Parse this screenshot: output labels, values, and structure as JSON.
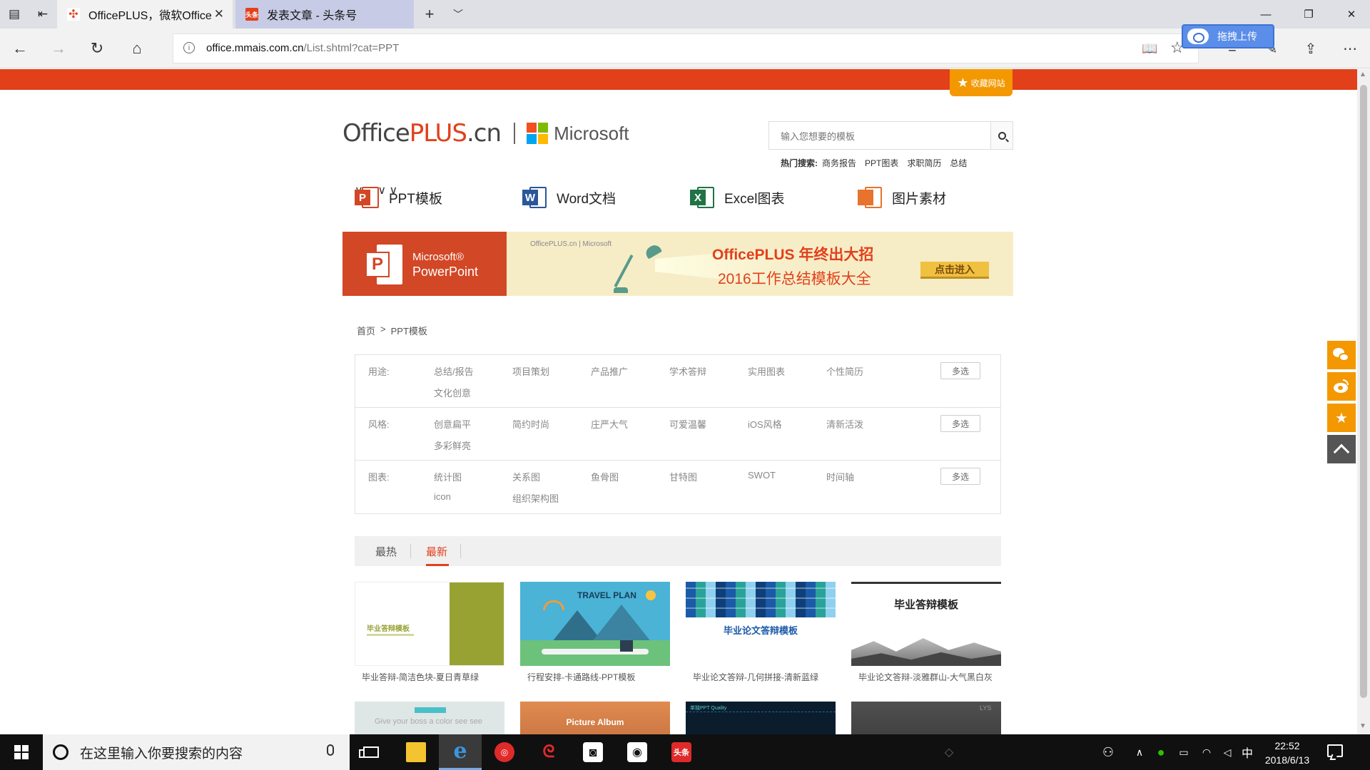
{
  "browser": {
    "tabs": [
      {
        "label": "OfficePLUS，微软Office",
        "active": true
      },
      {
        "label": "发表文章 - 头条号",
        "active": false,
        "favicon_text": "头条"
      }
    ],
    "url_domain": "office.mmais.com.cn",
    "url_path": "/List.shtml?cat=PPT",
    "upload_label": "拖拽上传"
  },
  "page": {
    "bookmark_label": "收藏网站",
    "logo": {
      "office": "Office",
      "plus": "PLUS",
      "cn": ".cn",
      "microsoft": "Microsoft"
    },
    "search": {
      "placeholder": "输入您想要的模板",
      "hot_label": "热门搜索:",
      "hot_terms": [
        "商务报告",
        "PPT图表",
        "求职简历",
        "总结"
      ]
    },
    "categories": [
      {
        "label": "PPT模板",
        "icon_letter": "P",
        "color": "#d24726"
      },
      {
        "label": "Word文档",
        "icon_letter": "W",
        "color": "#2b579a"
      },
      {
        "label": "Excel图表",
        "icon_letter": "X",
        "color": "#217346"
      },
      {
        "label": "图片素材",
        "icon_letter": "",
        "color": "#e8732c"
      }
    ],
    "banner": {
      "ms_line": "Microsoft®",
      "pp_line": "PowerPoint",
      "small_logo": "OfficePLUS.cn | Microsoft",
      "title": "OfficePLUS 年终出大招",
      "subtitle": "2016工作总结模板大全",
      "enter": "点击进入"
    },
    "breadcrumb": {
      "home": "首页",
      "sep": ">",
      "current": "PPT模板"
    },
    "filters": [
      {
        "label": "用途:",
        "items": [
          "总结/报告",
          "项目策划",
          "产品推广",
          "学术答辩",
          "实用图表",
          "个性简历",
          "文化创意"
        ],
        "multi": "多选"
      },
      {
        "label": "风格:",
        "items": [
          "创意扁平",
          "简约时尚",
          "庄严大气",
          "可爱温馨",
          "iOS风格",
          "清新活泼",
          "多彩鲜亮"
        ],
        "multi": "多选"
      },
      {
        "label": "图表:",
        "items": [
          "统计图",
          "关系图",
          "鱼骨图",
          "甘特图",
          "SWOT",
          "时间轴",
          "icon",
          "组织架构图"
        ],
        "multi": "多选"
      }
    ],
    "sort_tabs": [
      {
        "label": "最热",
        "active": false
      },
      {
        "label": "最新",
        "active": true
      }
    ],
    "templates": [
      {
        "title": "毕业答辩-简洁色块-夏日青草绿",
        "thumb_text": "毕业答辩模板"
      },
      {
        "title": "行程安排-卡通路线-PPT模板",
        "thumb_text": "TRAVEL PLAN"
      },
      {
        "title": "毕业论文答辩-几何拼接-清新蓝绿",
        "thumb_text": "毕业论文答辩模板"
      },
      {
        "title": "毕业论文答辩-淡雅群山-大气黑白灰",
        "thumb_text": "毕业答辩模板"
      },
      {
        "title": "",
        "thumb_text": "Give your boss a color see see"
      },
      {
        "title": "",
        "thumb_text": "Picture Album"
      },
      {
        "title": "",
        "thumb_text": "单独PPT Quality"
      },
      {
        "title": "",
        "thumb_text": "LYS"
      }
    ]
  },
  "taskbar": {
    "search_placeholder": "在这里输入你要搜索的内容",
    "ime": "中",
    "time": "22:52",
    "date": "2018/6/13",
    "toutiao_label": "头条"
  }
}
